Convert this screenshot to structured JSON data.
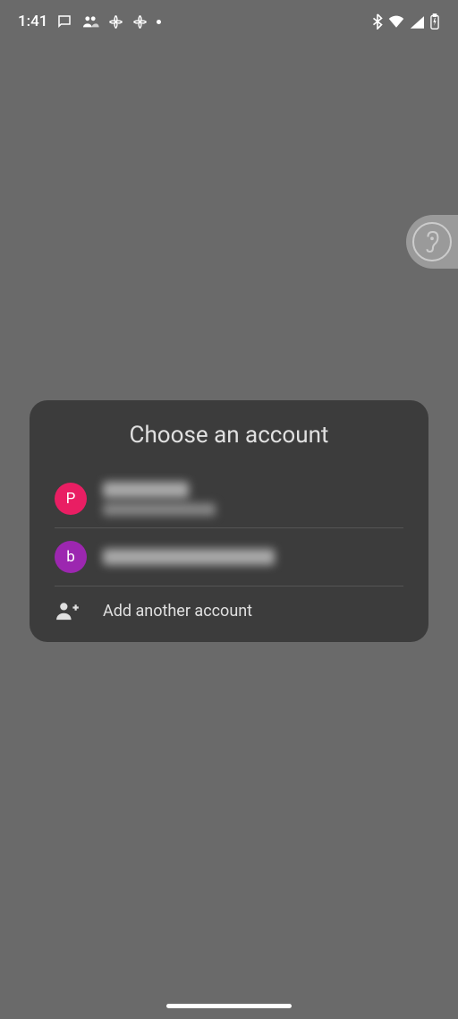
{
  "status": {
    "time": "1:41"
  },
  "dialog": {
    "title": "Choose an account",
    "accounts": [
      {
        "initial": "P",
        "avatar_color": "#e91e63",
        "name": "██████████",
        "email": "████████████"
      },
      {
        "initial": "b",
        "avatar_color": "#9c27b0",
        "name": "██████████████████"
      }
    ],
    "add_account_label": "Add another account"
  }
}
